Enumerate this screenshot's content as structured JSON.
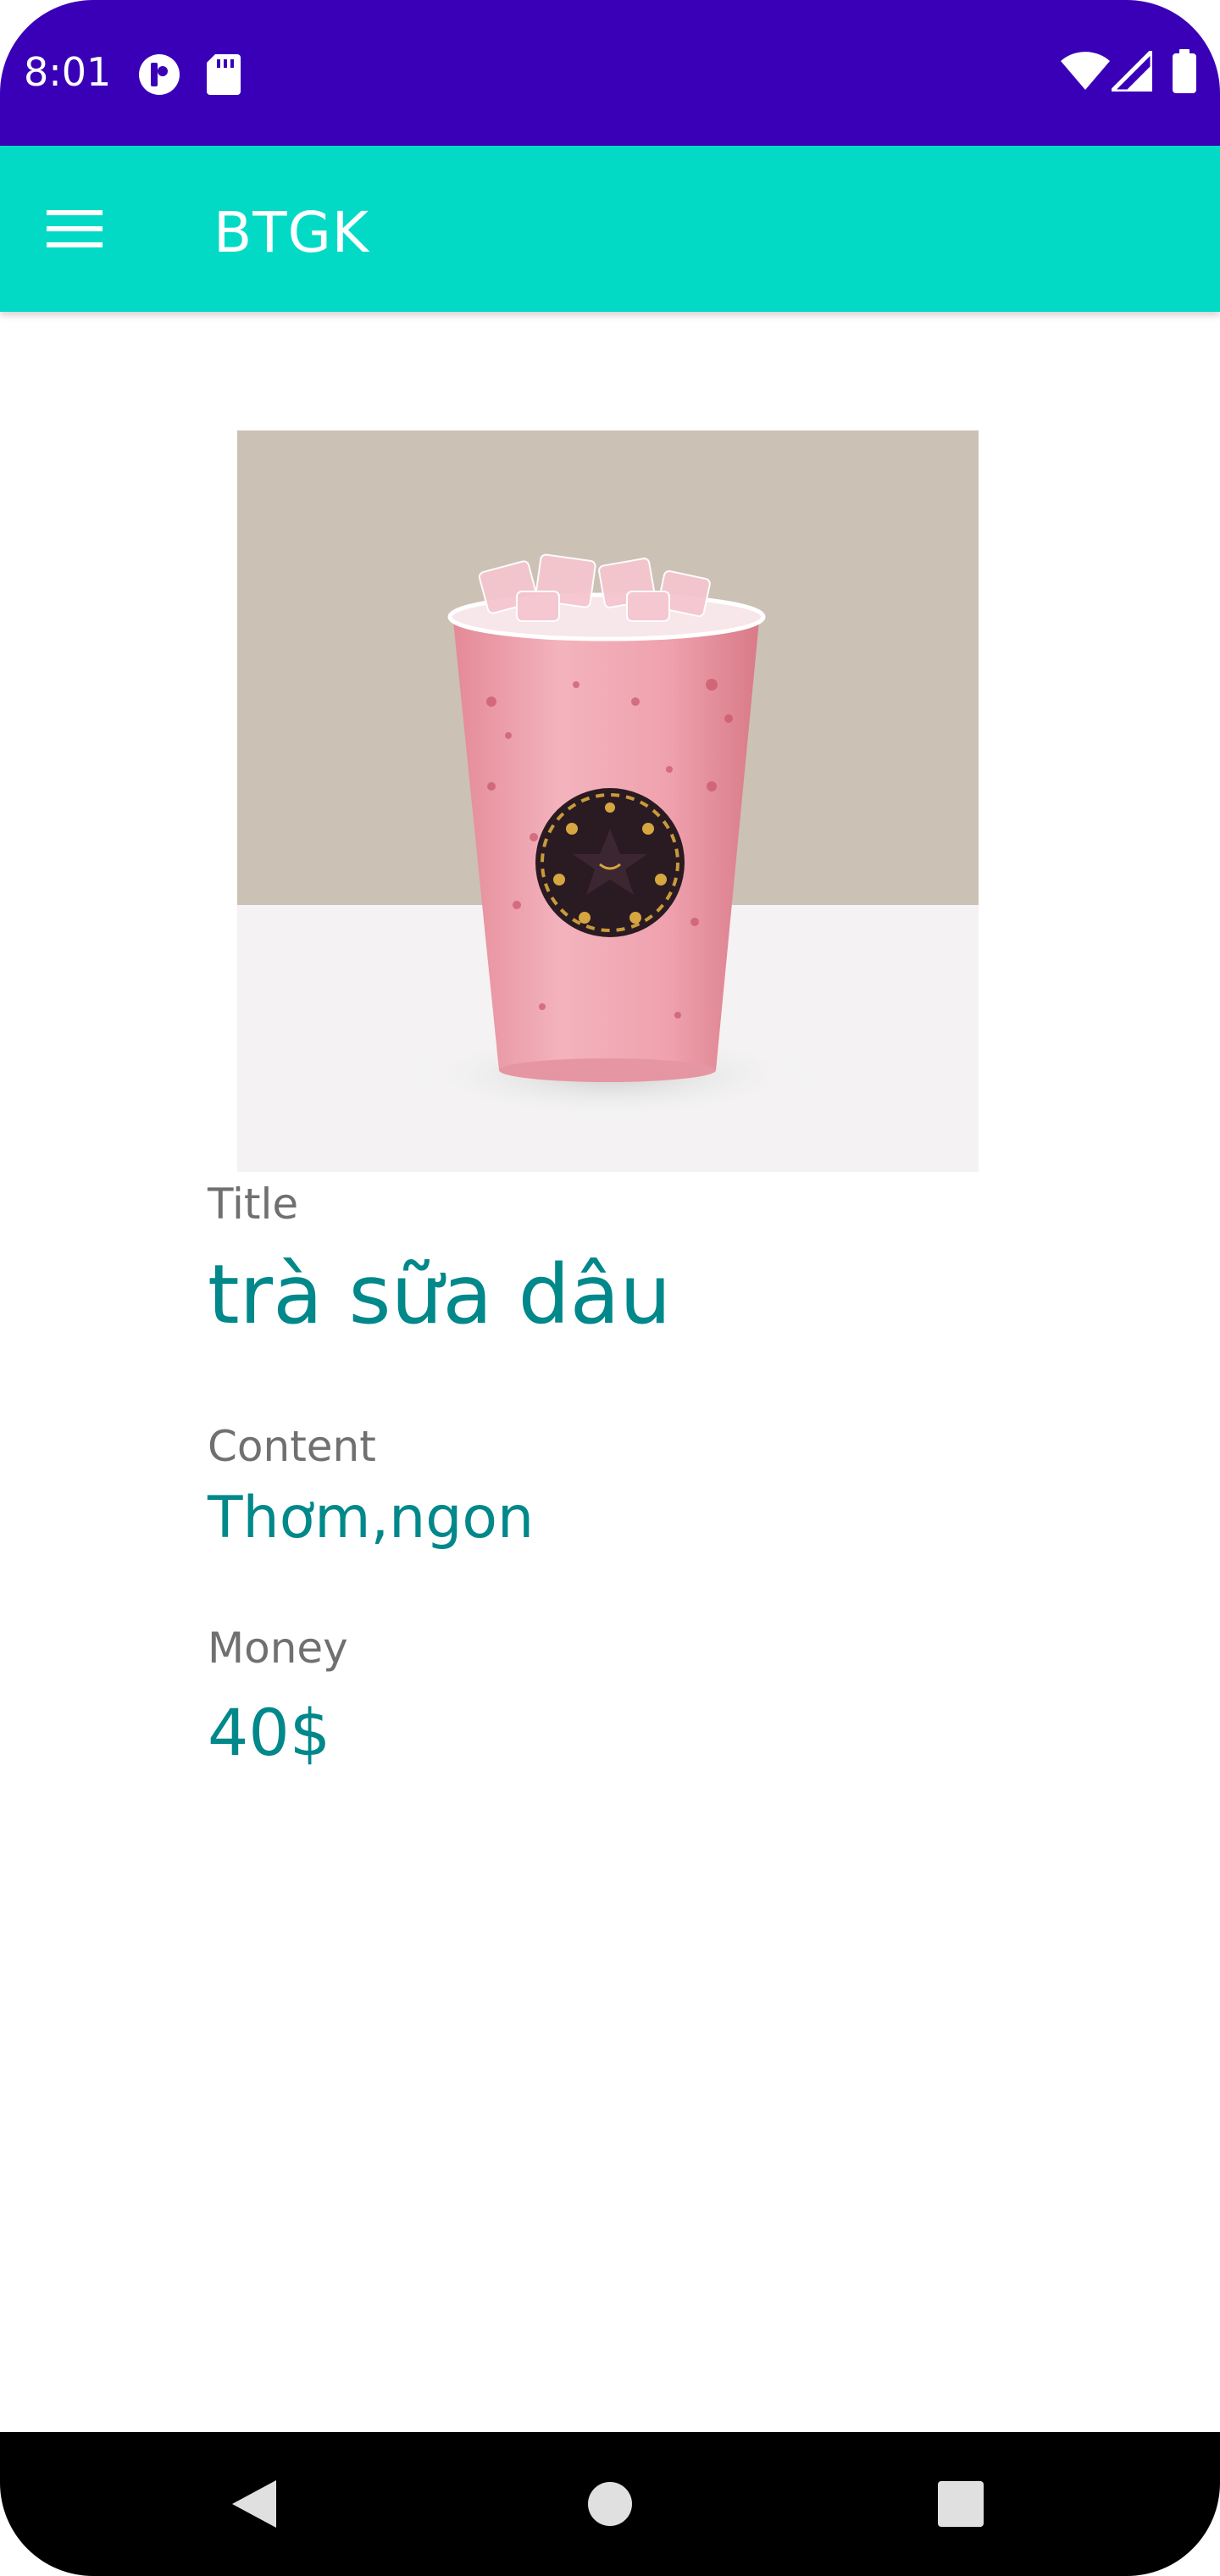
{
  "status_bar": {
    "time": "8:01",
    "icons": [
      "app-notification-icon",
      "sd-card-icon",
      "wifi-icon",
      "signal-icon",
      "battery-icon"
    ]
  },
  "app_bar": {
    "title": "BTGK",
    "menu_icon": "menu-icon"
  },
  "product": {
    "image_alt": "strawberry-milk-tea-cup",
    "title_label": "Title",
    "title_value": "trà sữa dâu",
    "content_label": "Content",
    "content_value": "Thơm,ngon",
    "money_label": "Money",
    "money_value": "40$"
  },
  "nav_bar": {
    "back_icon": "back-icon",
    "home_icon": "home-icon",
    "recents_icon": "recents-icon"
  },
  "colors": {
    "status_bar": "#3A00B8",
    "app_bar": "#03DAC5",
    "value_text": "#00888A",
    "label_text": "#707070"
  }
}
